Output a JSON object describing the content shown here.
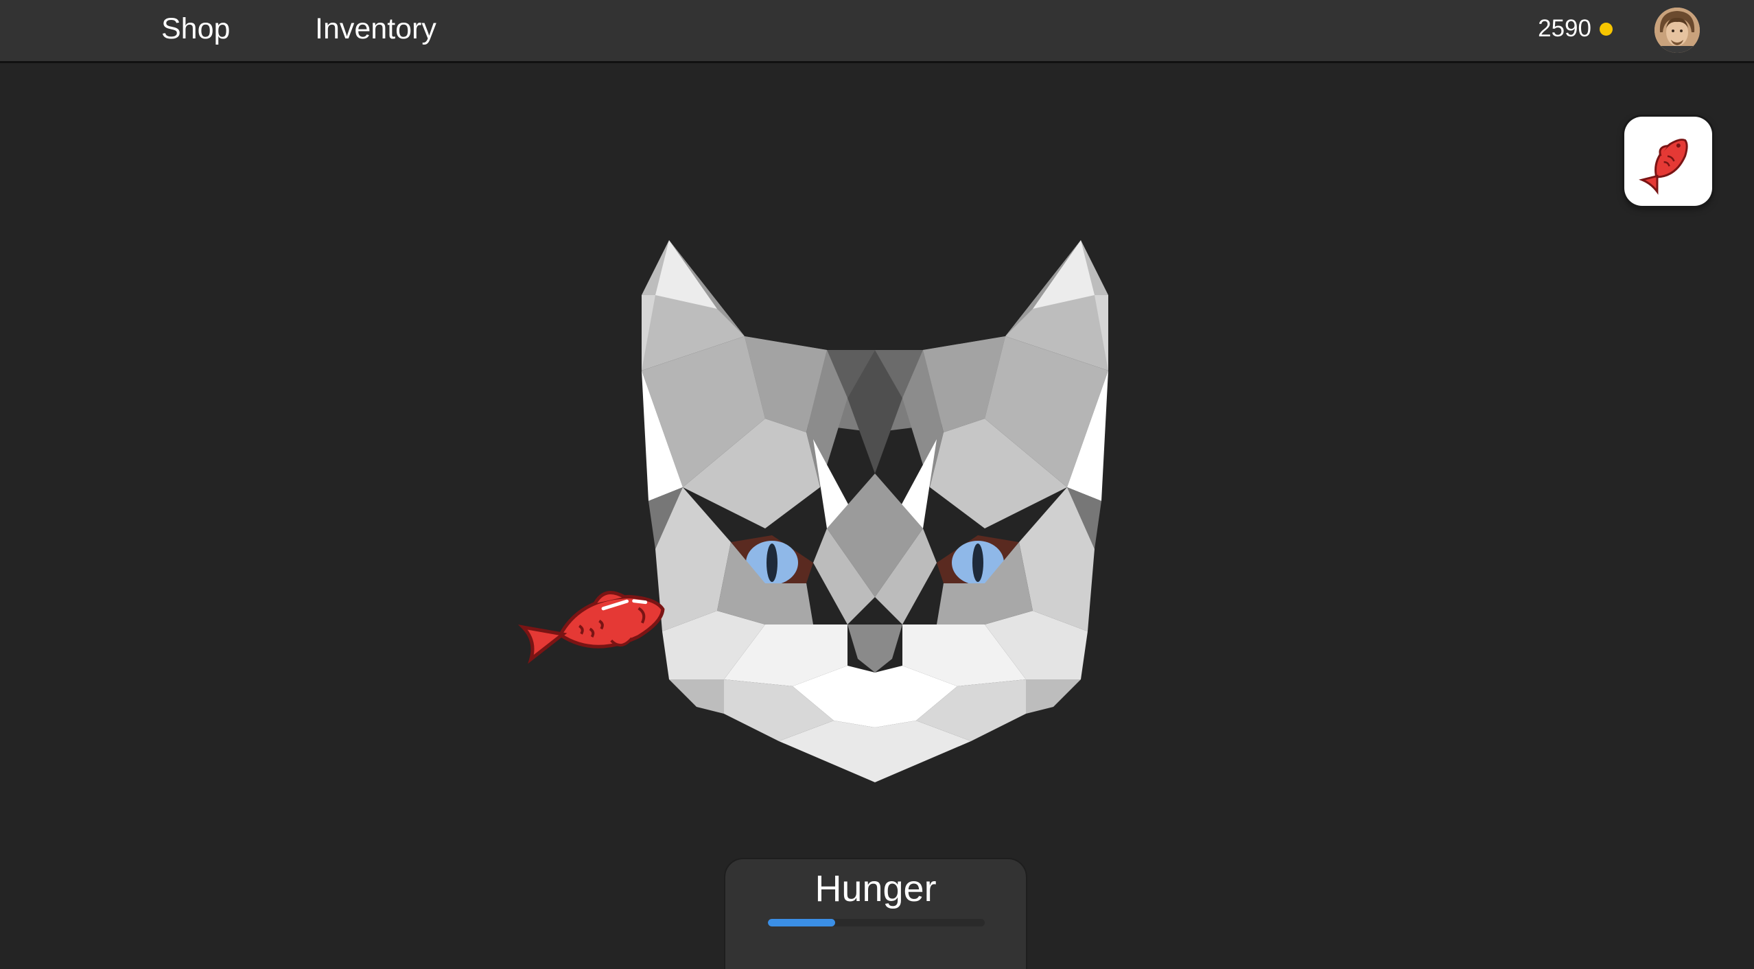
{
  "nav": {
    "shop_label": "Shop",
    "inventory_label": "Inventory"
  },
  "account": {
    "coins": "2590",
    "coin_icon": "coin-icon",
    "avatar_icon": "avatar-icon"
  },
  "food_button": {
    "icon": "fish-icon"
  },
  "pet": {
    "image": "lowpoly-cat-face",
    "held_item_icon": "fish-icon"
  },
  "hunger": {
    "label": "Hunger",
    "level": 0.31
  },
  "colors": {
    "background": "#242424",
    "topbar": "#333333",
    "coin": "#f7c600",
    "fish": "#e53935",
    "hunger_bar": "#3b8fe6"
  }
}
